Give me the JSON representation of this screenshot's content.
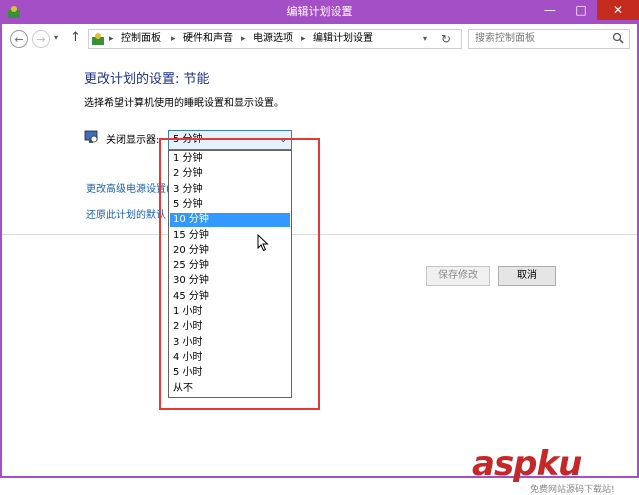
{
  "window": {
    "title": "编辑计划设置",
    "minimize": "—",
    "maximize": "□",
    "close": "✕"
  },
  "nav": {
    "back": "←",
    "forward": "→",
    "history": "▾",
    "up": "↑"
  },
  "address": {
    "crumbs": [
      "控制面板",
      "硬件和声音",
      "电源选项",
      "编辑计划设置"
    ],
    "separator": "▸",
    "dropdown": "▾",
    "refresh": "↻"
  },
  "search": {
    "placeholder": "搜索控制面板",
    "icon": "search-icon"
  },
  "content": {
    "title": "更改计划的设置: 节能",
    "subtitle": "选择希望计算机使用的睡眠设置和显示设置。",
    "display_label": "关闭显示器:",
    "selected": "5 分钟",
    "advanced_link": "更改高级电源设置(",
    "restore_link": "还原此计划的默认"
  },
  "dropdown": {
    "options": [
      "1 分钟",
      "2 分钟",
      "3 分钟",
      "5 分钟",
      "10 分钟",
      "15 分钟",
      "20 分钟",
      "25 分钟",
      "30 分钟",
      "45 分钟",
      "1 小时",
      "2 小时",
      "3 小时",
      "4 小时",
      "5 小时",
      "从不"
    ],
    "highlighted_index": 4
  },
  "buttons": {
    "save": "保存修改",
    "cancel": "取消"
  },
  "watermark": {
    "main": "aspku",
    "sub": "免费网站源码下载站!"
  },
  "colors": {
    "titlebar": "#a54fc6",
    "link": "#1a5fb4",
    "heading": "#1e3287",
    "highlight": "#e53935",
    "selection": "#3399ff"
  }
}
